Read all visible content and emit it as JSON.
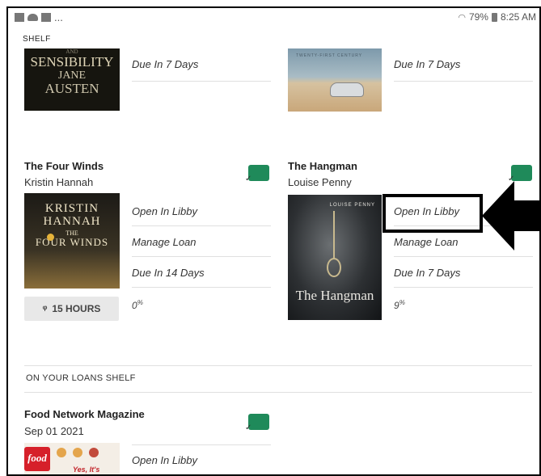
{
  "status": {
    "dots": "...",
    "battery": "79%",
    "time": "8:25 AM"
  },
  "shelf": {
    "title": "SHELF"
  },
  "top_books": [
    {
      "cover_lines": [
        "AND",
        "SENSIBILITY",
        "JANE",
        "AUSTEN"
      ],
      "due": "Due In 7 Days"
    },
    {
      "cover_tag": "TWENTY-FIRST CENTURY",
      "due": "Due In 7 Days"
    }
  ],
  "books": [
    {
      "title": "The Four Winds",
      "author": "Kristin Hannah",
      "cover": {
        "author": "KRISTIN HANNAH",
        "the": "THE",
        "title": "FOUR WINDS"
      },
      "actions": [
        "Open In Libby",
        "Manage Loan"
      ],
      "due": "Due In 14 Days",
      "audio": "15 HOURS",
      "progress_percent": "0"
    },
    {
      "title": "The Hangman",
      "author": "Louise Penny",
      "cover": {
        "author": "LOUISE PENNY",
        "title": "The Hangman"
      },
      "actions": [
        "Open In Libby",
        "Manage Loan"
      ],
      "due": "Due In 7 Days",
      "progress_percent": "9"
    }
  ],
  "loans_shelf": {
    "label": "ON YOUR LOANS SHELF",
    "items": [
      {
        "title": "Food Network Magazine",
        "date": "Sep 01 2021",
        "cover_logo": "food",
        "cover_text": "Yes, It's",
        "action": "Open In Libby"
      }
    ]
  },
  "percent_symbol": "%",
  "colors": {
    "sync_badge": "#1f8a5a",
    "highlight": "#000000"
  }
}
